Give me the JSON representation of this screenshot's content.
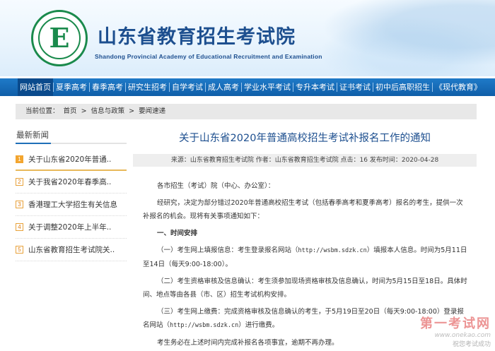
{
  "header": {
    "logo_letter": "E",
    "logo_ring_text": "Shandong Educational Admission & Examination 山东省教育招生考试院",
    "title": "山东省教育招生考试院",
    "subtitle": "Shandong Provincial Academy of Educational Recruitment and Examination"
  },
  "nav": {
    "items": [
      "网站首页",
      "夏季高考",
      "春季高考",
      "研究生招考",
      "自学考试",
      "成人高考",
      "学业水平考试",
      "专升本考试",
      "证书考试",
      "初中后高职招生",
      "《现代教育》"
    ]
  },
  "breadcrumb": {
    "prefix": "当前位置：",
    "items": [
      "首页",
      "信息与政策",
      "要闻速递"
    ],
    "sep": ">"
  },
  "sidebar": {
    "heading": "最新新闻",
    "items": [
      {
        "num": "1",
        "text": "关于山东省2020年普通.."
      },
      {
        "num": "2",
        "text": "关于我省2020年春季高.."
      },
      {
        "num": "3",
        "text": "香港理工大学招生有关信息"
      },
      {
        "num": "4",
        "text": "关于调整2020年上半年.."
      },
      {
        "num": "5",
        "text": "山东省教育招生考试院关.."
      }
    ]
  },
  "article": {
    "title": "关于山东省2020年普通高校招生考试补报名工作的通知",
    "meta": "来源：山东省教育招生考试院 作者：山东省教育招生考试院 点击：16 发布时间：2020-04-28",
    "greeting": "各市招生（考试）院（中心、办公室）：",
    "p1": "经研究，决定为部分错过2020年普通高校招生考试（包括春季高考和夏季高考）报名的考生，提供一次补报名的机会。现将有关事项通知如下：",
    "h1": "一、时间安排",
    "p2a": "（一）考生网上填报信息：考生登录报名网站（",
    "p2_url": "http://wsbm.sdzk.cn",
    "p2b": "）填报本人信息。时间为5月11日至14日（每天9:00-18:00）。",
    "p3": "（二）考生资格审核及信息确认：考生须参加现场资格审核及信息确认，时间为5月15日至18日。具体时间、地点等由各县（市、区）招生考试机构安排。",
    "p4a": "（三）考生网上缴费：完成资格审核及信息确认的考生，于5月19日至20日（每天9:00-18:00）登录报名网站（",
    "p4_url": "http://wsbm.sdzk.cn",
    "p4b": "）进行缴费。",
    "p5": "考生务必在上述时间内完成补报名各项事宜，逾期不再办理。"
  },
  "watermark": {
    "big": "第一考试网",
    "url": "www.onekao.com",
    "slogan": "祝您考试成功"
  }
}
